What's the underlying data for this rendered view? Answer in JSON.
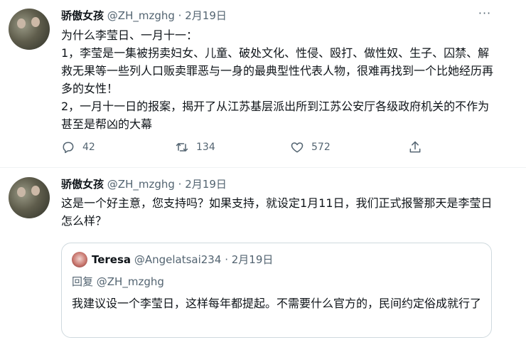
{
  "tweets": [
    {
      "name": "骄傲女孩",
      "handle": "@ZH_mzghg",
      "sep": "·",
      "date": "2月19日",
      "more": "···",
      "text": "为什么李莹日、一月十一：\n1，李莹是一集被拐卖妇女、儿童、破处文化、性侵、殴打、做性奴、生子、囚禁、解救无果等一些列人口贩卖罪恶与一身的最典型性代表人物，很难再找到一个比她经历再多的女性！\n2，一月十一日的报案，揭开了从江苏基层派出所到江苏公安厅各级政府机关的不作为甚至是帮凶的大幕",
      "replies": "42",
      "retweets": "134",
      "likes": "572"
    },
    {
      "name": "骄傲女孩",
      "handle": "@ZH_mzghg",
      "sep": "·",
      "date": "2月19日",
      "text": "这是一个好主意，您支持吗？如果支持，就设定1月11日，我们正式报警那天是李莹日怎么样？",
      "quote": {
        "name": "Teresa",
        "handle": "@Angelatsai234",
        "sep": "·",
        "date": "2月19日",
        "reply_prefix": "回复 ",
        "reply_to": "@ZH_mzghg",
        "text": "我建议设一个李莹日，这样每年都提起。不需要什么官方的，民间约定俗成就行了"
      }
    }
  ],
  "icons": {
    "reply": "reply-icon",
    "retweet": "retweet-icon",
    "like": "heart-icon",
    "share": "share-icon",
    "more": "more-icon"
  },
  "colors": {
    "text": "#0f1419",
    "secondary": "#536471",
    "border": "#cfd9de"
  }
}
